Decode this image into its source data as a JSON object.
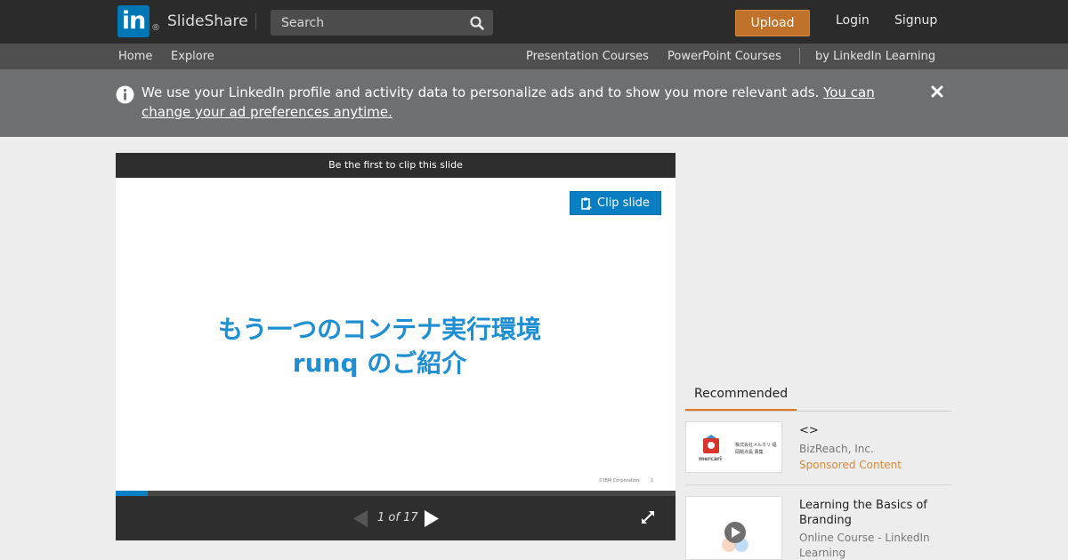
{
  "header": {
    "logo_text": "in",
    "logo_registered": "®",
    "brand": "SlideShare",
    "search_placeholder": "Search",
    "upload": "Upload",
    "login": "Login",
    "signup": "Signup"
  },
  "subnav": {
    "home": "Home",
    "explore": "Explore",
    "presentation_courses": "Presentation Courses",
    "powerpoint_courses": "PowerPoint Courses",
    "linkedin_learning": "by LinkedIn Learning"
  },
  "notice": {
    "text": "We use your LinkedIn profile and activity data to personalize ads and to show you more relevant ads. ",
    "link": "You can change your ad preferences anytime."
  },
  "player": {
    "clip_bar": "Be the first to clip this slide",
    "clip_button": "Clip slide",
    "slide_title_line1": "もう一つのコンテナ実行環境",
    "slide_title_line2": "runq のご紹介",
    "slide_footer": "©IBM Corporation",
    "slide_number": "1",
    "page_indicator": "1 of 17",
    "current_page": 1,
    "total_pages": 17
  },
  "recommended": {
    "tab": "Recommended",
    "items": [
      {
        "title": "<>",
        "subtitle": "BizReach, Inc.",
        "badge": "Sponsored Content",
        "thumb_logo": "mercari",
        "thumb_text": "株式会社メルカリ 福岡拠点長 募集"
      },
      {
        "title": "Learning the Basics of Branding",
        "subtitle": "Online Course - LinkedIn Learning"
      }
    ]
  },
  "colors": {
    "topbar": "#2b2b2b",
    "subnav": "#4f4f4f",
    "notice": "#6e6f71",
    "upload": "#c0712a",
    "accent_blue": "#0a7ec2",
    "slide_title": "#1d8fd2",
    "recommended_underline": "#e07a27"
  }
}
